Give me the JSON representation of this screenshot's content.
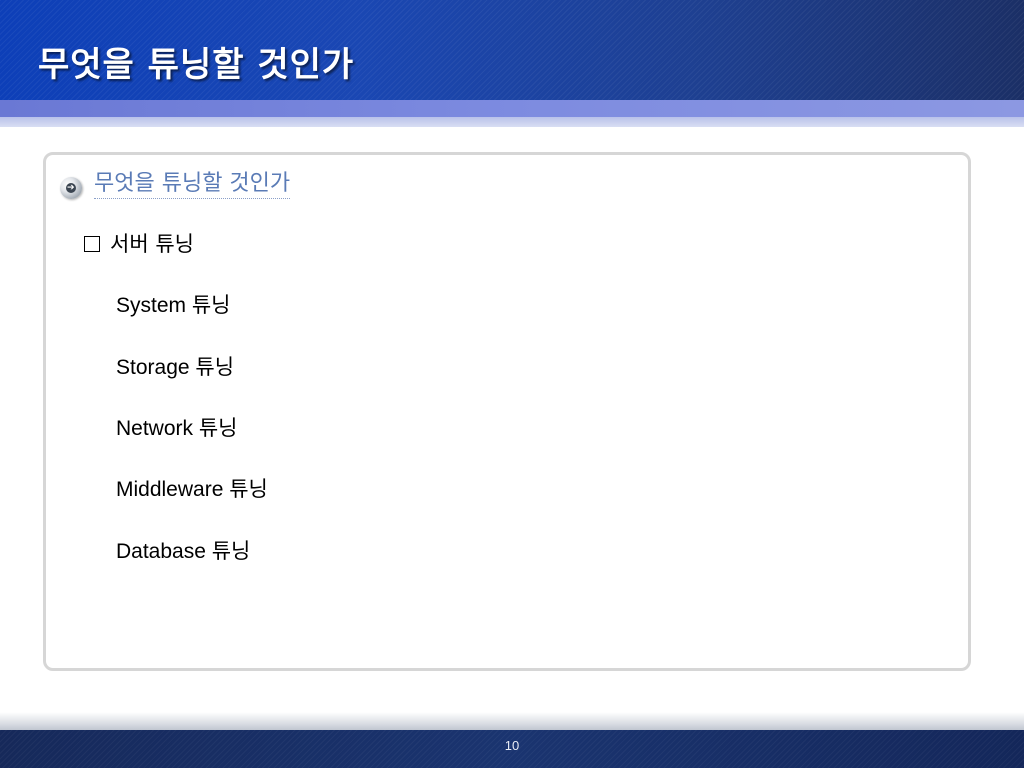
{
  "slide": {
    "title": "무엇을 튜닝할 것인가",
    "section_title": "무엇을 튜닝할 것인가",
    "list_header": "서버 튜닝",
    "items": [
      "System 튜닝",
      "Storage 튜닝",
      "Network 튜닝",
      "Middleware 튜닝",
      "Database 튜닝"
    ],
    "page_number": "10"
  },
  "icons": {
    "bullet": "arrow-circle-icon",
    "list_marker": "checkbox-square-icon"
  },
  "colors": {
    "header_blue": "#1a47b3",
    "stripe_blue": "#7d8be0",
    "section_title": "#5a7bb6",
    "footer_navy": "#1a3470"
  }
}
